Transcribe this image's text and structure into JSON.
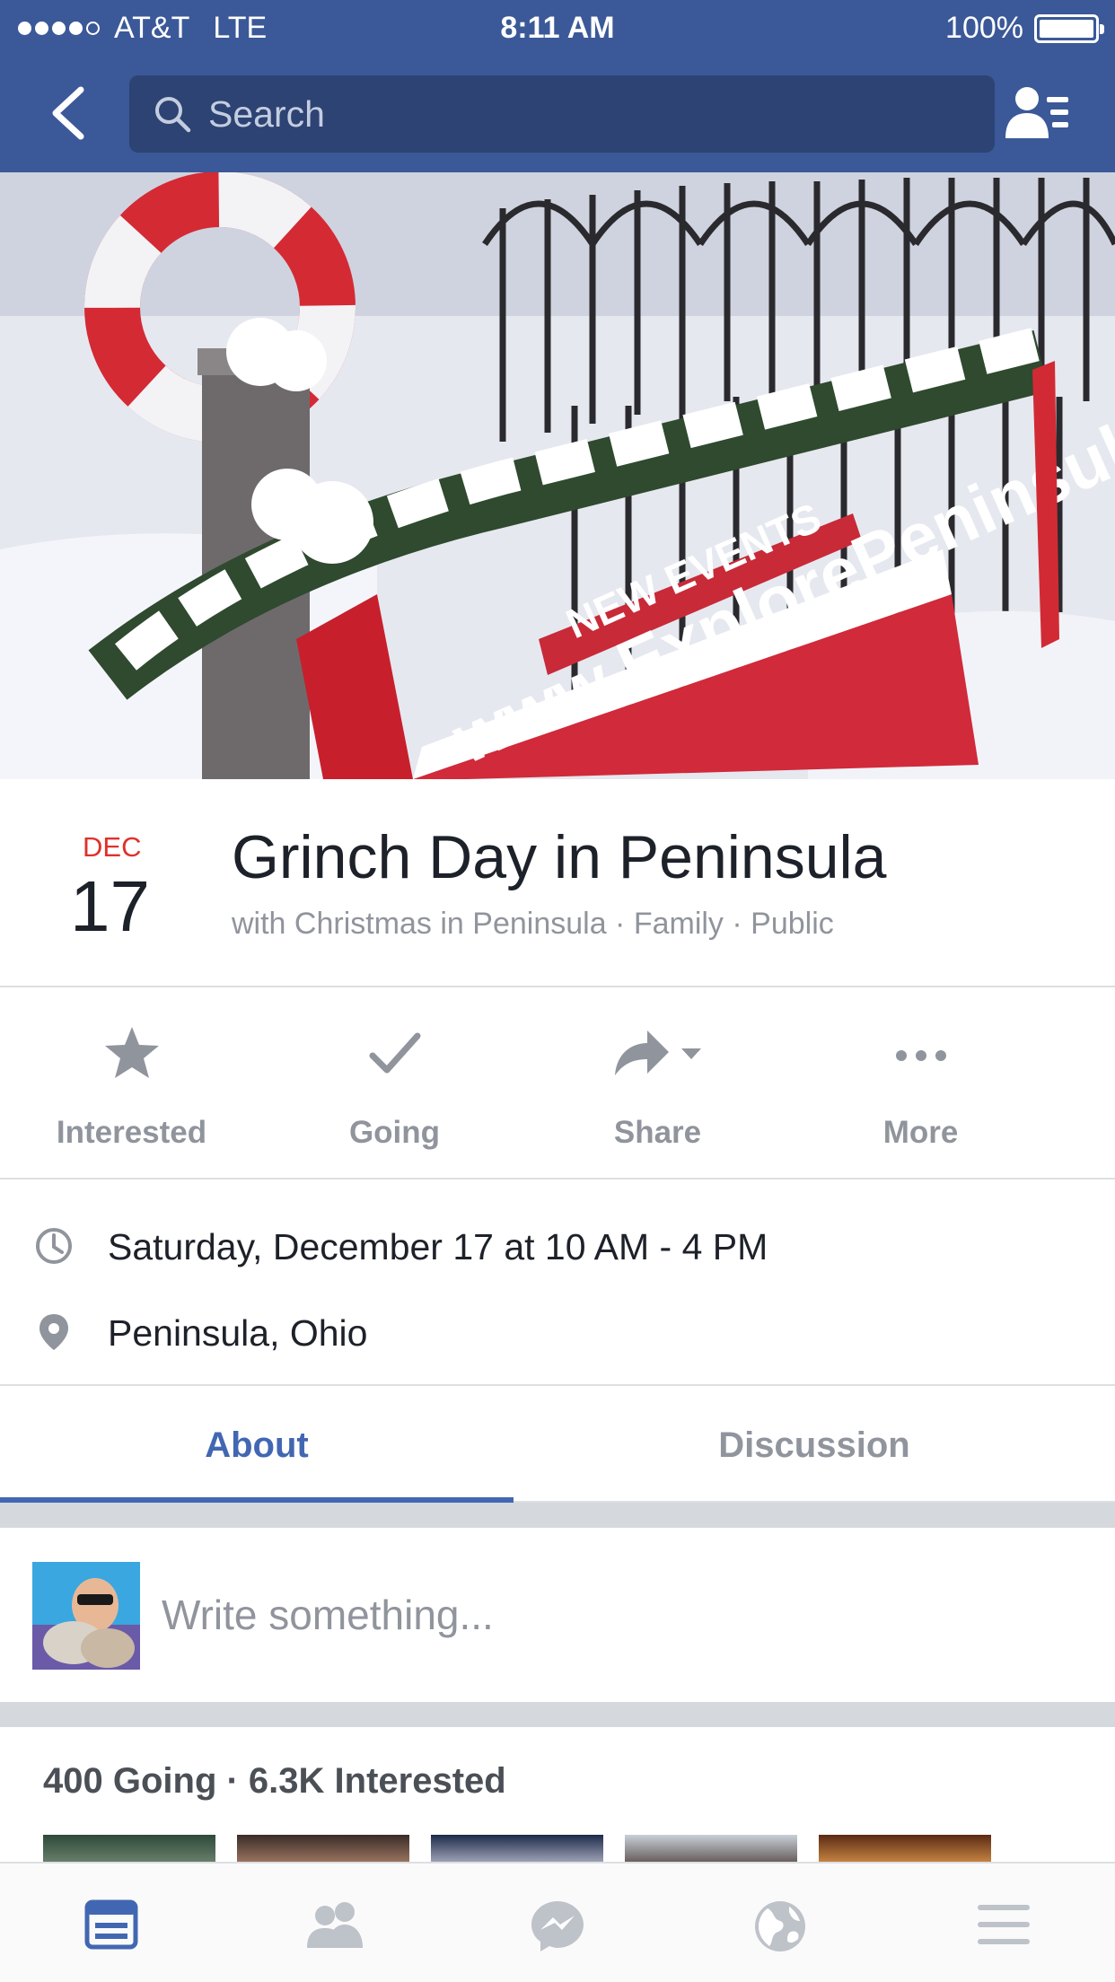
{
  "status_bar": {
    "carrier": "AT&T",
    "network": "LTE",
    "time": "8:11 AM",
    "battery": "100%",
    "signal_bars_filled": 4,
    "signal_bars_total": 5
  },
  "nav": {
    "search_placeholder": "Search",
    "back_icon": "chevron-left-icon",
    "friends_icon": "friend-list-icon"
  },
  "cover": {
    "banner_text": "www.ExplorePeninsula.com",
    "banner_upper_text": "NEW EVENTS"
  },
  "event": {
    "month": "DEC",
    "day": "17",
    "title": "Grinch Day in Peninsula",
    "subtitle": "with Christmas in Peninsula · Family · Public"
  },
  "actions": [
    {
      "label": "Interested",
      "icon": "star-icon"
    },
    {
      "label": "Going",
      "icon": "checkmark-icon"
    },
    {
      "label": "Share",
      "icon": "share-arrow-icon"
    },
    {
      "label": "More",
      "icon": "more-dots-icon"
    }
  ],
  "details": {
    "time": "Saturday, December 17 at 10 AM - 4 PM",
    "location": "Peninsula, Ohio"
  },
  "tabs": {
    "about": "About",
    "discussion": "Discussion",
    "active": "About"
  },
  "composer": {
    "placeholder": "Write something..."
  },
  "going": {
    "summary": "400 Going · 6.3K Interested"
  },
  "tabbar": [
    {
      "icon": "news-feed-icon",
      "active": true
    },
    {
      "icon": "friend-requests-icon",
      "active": false
    },
    {
      "icon": "messenger-icon",
      "active": false
    },
    {
      "icon": "notifications-globe-icon",
      "active": false
    },
    {
      "icon": "menu-icon",
      "active": false
    }
  ],
  "colors": {
    "brand": "#3b5998",
    "accent": "#4267b2",
    "date_red": "#e0312c",
    "muted_text": "#90949c"
  }
}
